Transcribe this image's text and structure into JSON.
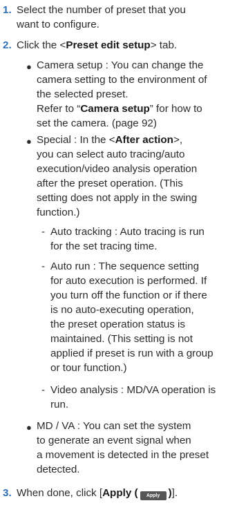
{
  "steps": [
    {
      "num": "1.",
      "lines": [
        "Select the number of preset that you",
        "want to configure."
      ]
    },
    {
      "num": "2.",
      "pre": "Click the <",
      "bold": "Preset edit setup",
      "post": "> tab."
    },
    {
      "num": "3.",
      "pre": "When done, click [",
      "bold": "Apply (",
      "post_bold": ")",
      "post": "]."
    }
  ],
  "camera_setup": {
    "lines": [
      "Camera setup : You can change the",
      "camera setting to the environment of",
      "the selected preset."
    ],
    "ref_pre": "Refer to “",
    "ref_bold": "Camera setup",
    "ref_post": "” for how to",
    "ref_line2": "set the camera. (page 92)"
  },
  "special": {
    "pre": "Special : In the <",
    "bold": "After action",
    "post": ">,",
    "lines": [
      "you can select auto tracing/auto",
      "execution/video analysis operation",
      "after the preset operation. (This",
      "setting does not apply in the swing",
      "function.)"
    ]
  },
  "auto_tracking": {
    "lines": [
      "Auto tracking : Auto tracing is run",
      "for the set tracing time."
    ]
  },
  "auto_run": {
    "lines": [
      "Auto run : The sequence setting",
      "for auto execution is performed. If",
      "you turn off the function or if there",
      "is no auto-executing operation,",
      "the preset operation status is",
      "maintained. (This setting is not",
      "applied if preset is run with a group",
      "or tour function.)"
    ]
  },
  "video_analysis": {
    "lines": [
      "Video analysis : MD/VA operation is",
      "run."
    ]
  },
  "md_va": {
    "lines": [
      "MD / VA : You can set the system",
      "to generate an event signal when",
      "a movement is detected in the preset",
      "detected."
    ]
  },
  "apply_button_label": "Apply",
  "markers": {
    "bullet": "●",
    "dash": "-"
  }
}
